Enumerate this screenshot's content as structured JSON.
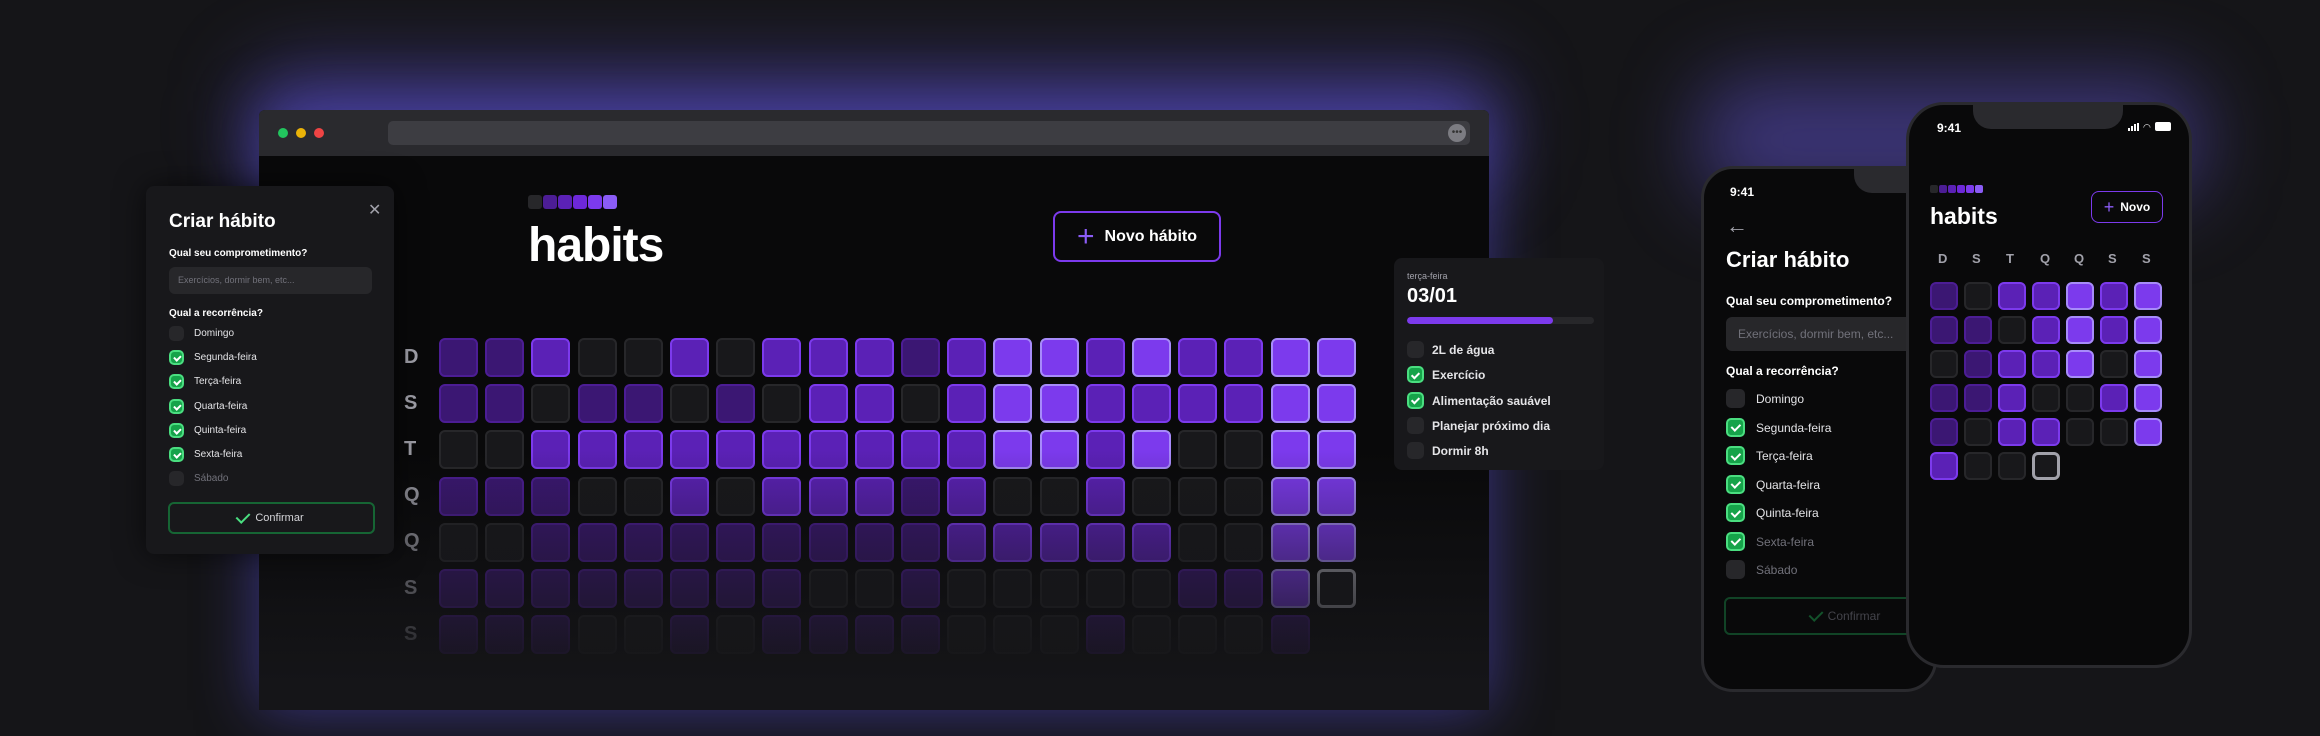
{
  "browser": {
    "logo_colors": [
      "#27272a",
      "#4c1d95",
      "#5b21b6",
      "#6d28d9",
      "#7c3aed",
      "#8b5cf6"
    ],
    "title": "habits",
    "new_habit_button": "Novo hábito",
    "url_icon": "ellipsis-icon",
    "row_labels": [
      "D",
      "S",
      "T",
      "Q",
      "Q",
      "S",
      "S"
    ],
    "grid_levels": [
      [
        3,
        3,
        4,
        0,
        0,
        4,
        0,
        4,
        4,
        4,
        3,
        4,
        5,
        5,
        4,
        5,
        4,
        4,
        5,
        5
      ],
      [
        3,
        3,
        0,
        3,
        3,
        0,
        3,
        0,
        4,
        4,
        0,
        4,
        5,
        5,
        4,
        4,
        4,
        4,
        5,
        5
      ],
      [
        0,
        0,
        4,
        4,
        4,
        4,
        4,
        4,
        4,
        4,
        4,
        4,
        5,
        5,
        4,
        5,
        0,
        0,
        5,
        5
      ],
      [
        3,
        3,
        3,
        0,
        0,
        4,
        0,
        4,
        4,
        4,
        3,
        4,
        0,
        0,
        4,
        0,
        0,
        0,
        5,
        5
      ],
      [
        0,
        0,
        3,
        3,
        3,
        3,
        3,
        3,
        3,
        3,
        3,
        4,
        4,
        4,
        4,
        4,
        0,
        0,
        5,
        5
      ],
      [
        3,
        3,
        3,
        3,
        3,
        3,
        3,
        3,
        0,
        0,
        3,
        0,
        0,
        0,
        0,
        0,
        3,
        3,
        5,
        "T"
      ],
      [
        3,
        3,
        3,
        0,
        0,
        3,
        0,
        3,
        3,
        3,
        3,
        0,
        0,
        0,
        3,
        0,
        0,
        0,
        3,
        null
      ]
    ]
  },
  "modal_desktop": {
    "title": "Criar hábito",
    "close_icon": "close-icon",
    "commitment_label": "Qual seu comprometimento?",
    "commitment_placeholder": "Exercícios, dormir bem, etc...",
    "recurrence_label": "Qual a recorrência?",
    "days": [
      {
        "label": "Domingo",
        "checked": false
      },
      {
        "label": "Segunda-feira",
        "checked": true
      },
      {
        "label": "Terça-feira",
        "checked": true
      },
      {
        "label": "Quarta-feira",
        "checked": true
      },
      {
        "label": "Quinta-feira",
        "checked": true
      },
      {
        "label": "Sexta-feira",
        "checked": true
      },
      {
        "label": "Sábado",
        "checked": false
      }
    ],
    "confirm": "Confirmar"
  },
  "popover": {
    "weekday": "terça-feira",
    "date": "03/01",
    "progress": 0.78,
    "habits": [
      {
        "label": "2L de água",
        "checked": false
      },
      {
        "label": "Exercício",
        "checked": true
      },
      {
        "label": "Alimentação sauável",
        "checked": true
      },
      {
        "label": "Planejar próximo dia",
        "checked": false
      },
      {
        "label": "Dormir 8h",
        "checked": false
      }
    ]
  },
  "phone_back": {
    "time": "9:41",
    "back_icon": "arrow-left-icon",
    "title": "Criar hábito",
    "commitment_label": "Qual seu comprometimento?",
    "commitment_placeholder": "Exercícios, dormir bem, etc...",
    "recurrence_label": "Qual a recorrência?",
    "days": [
      {
        "label": "Domingo",
        "checked": false
      },
      {
        "label": "Segunda-feira",
        "checked": true
      },
      {
        "label": "Terça-feira",
        "checked": true
      },
      {
        "label": "Quarta-feira",
        "checked": true
      },
      {
        "label": "Quinta-feira",
        "checked": true
      },
      {
        "label": "Sexta-feira",
        "checked": true
      },
      {
        "label": "Sábado",
        "checked": false
      }
    ],
    "confirm": "Confirmar"
  },
  "phone_front": {
    "time": "9:41",
    "status_icons": [
      "signal-icon",
      "wifi-icon",
      "battery-icon"
    ],
    "title": "habits",
    "new_button": "Novo",
    "week_labels": [
      "D",
      "S",
      "T",
      "Q",
      "Q",
      "S",
      "S"
    ],
    "grid_levels": [
      [
        3,
        0,
        4,
        4,
        5,
        4,
        5
      ],
      [
        3,
        3,
        0,
        4,
        5,
        4,
        5
      ],
      [
        0,
        3,
        4,
        4,
        5,
        0,
        5
      ],
      [
        3,
        3,
        4,
        0,
        0,
        4,
        5
      ],
      [
        3,
        0,
        4,
        4,
        0,
        0,
        5
      ],
      [
        4,
        0,
        0,
        "T"
      ]
    ]
  }
}
